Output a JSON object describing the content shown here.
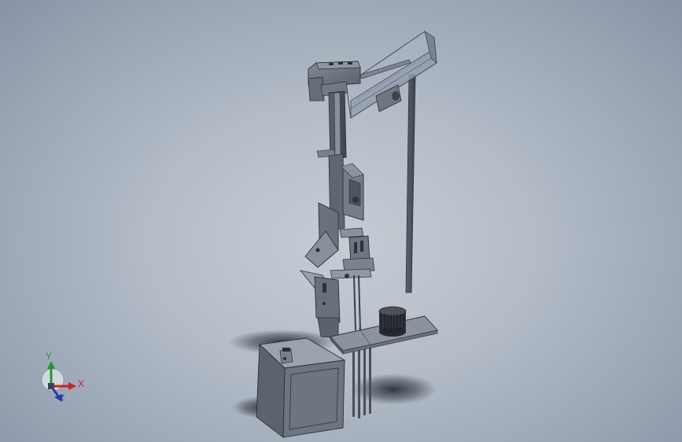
{
  "viewport": {
    "background_top": "#c6ccd4",
    "background_edge": "#8794a6"
  },
  "triad": {
    "y_label": "Y",
    "x_label": "X",
    "z_label": "Z",
    "y_color": "#1f9a2a",
    "x_color": "#c0262a",
    "z_color": "#2a3aa8"
  },
  "model": {
    "icon": "3d-assembly-model",
    "part_color": "#6e7480",
    "edge_color": "#2c3038",
    "glass_color": "#a9b3c2"
  }
}
